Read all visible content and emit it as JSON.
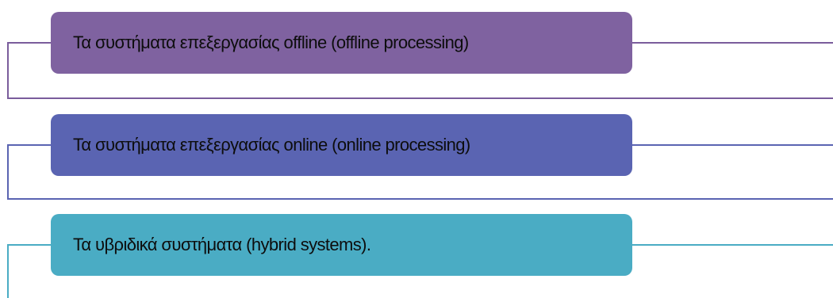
{
  "diagram": {
    "items": [
      {
        "label": "Τα συστήματα επεξεργασίας offline (offline processing)",
        "fill_color": "#7f62a0",
        "line_color": "#7a5d9c"
      },
      {
        "label": "Τα συστήματα επεξεργασίας online (online processing)",
        "fill_color": "#5a64b2",
        "line_color": "#5a64b2"
      },
      {
        "label": "Τα υβριδικά συστήματα (hybrid systems).",
        "fill_color": "#4aacc4",
        "line_color": "#4aacc4"
      }
    ]
  }
}
